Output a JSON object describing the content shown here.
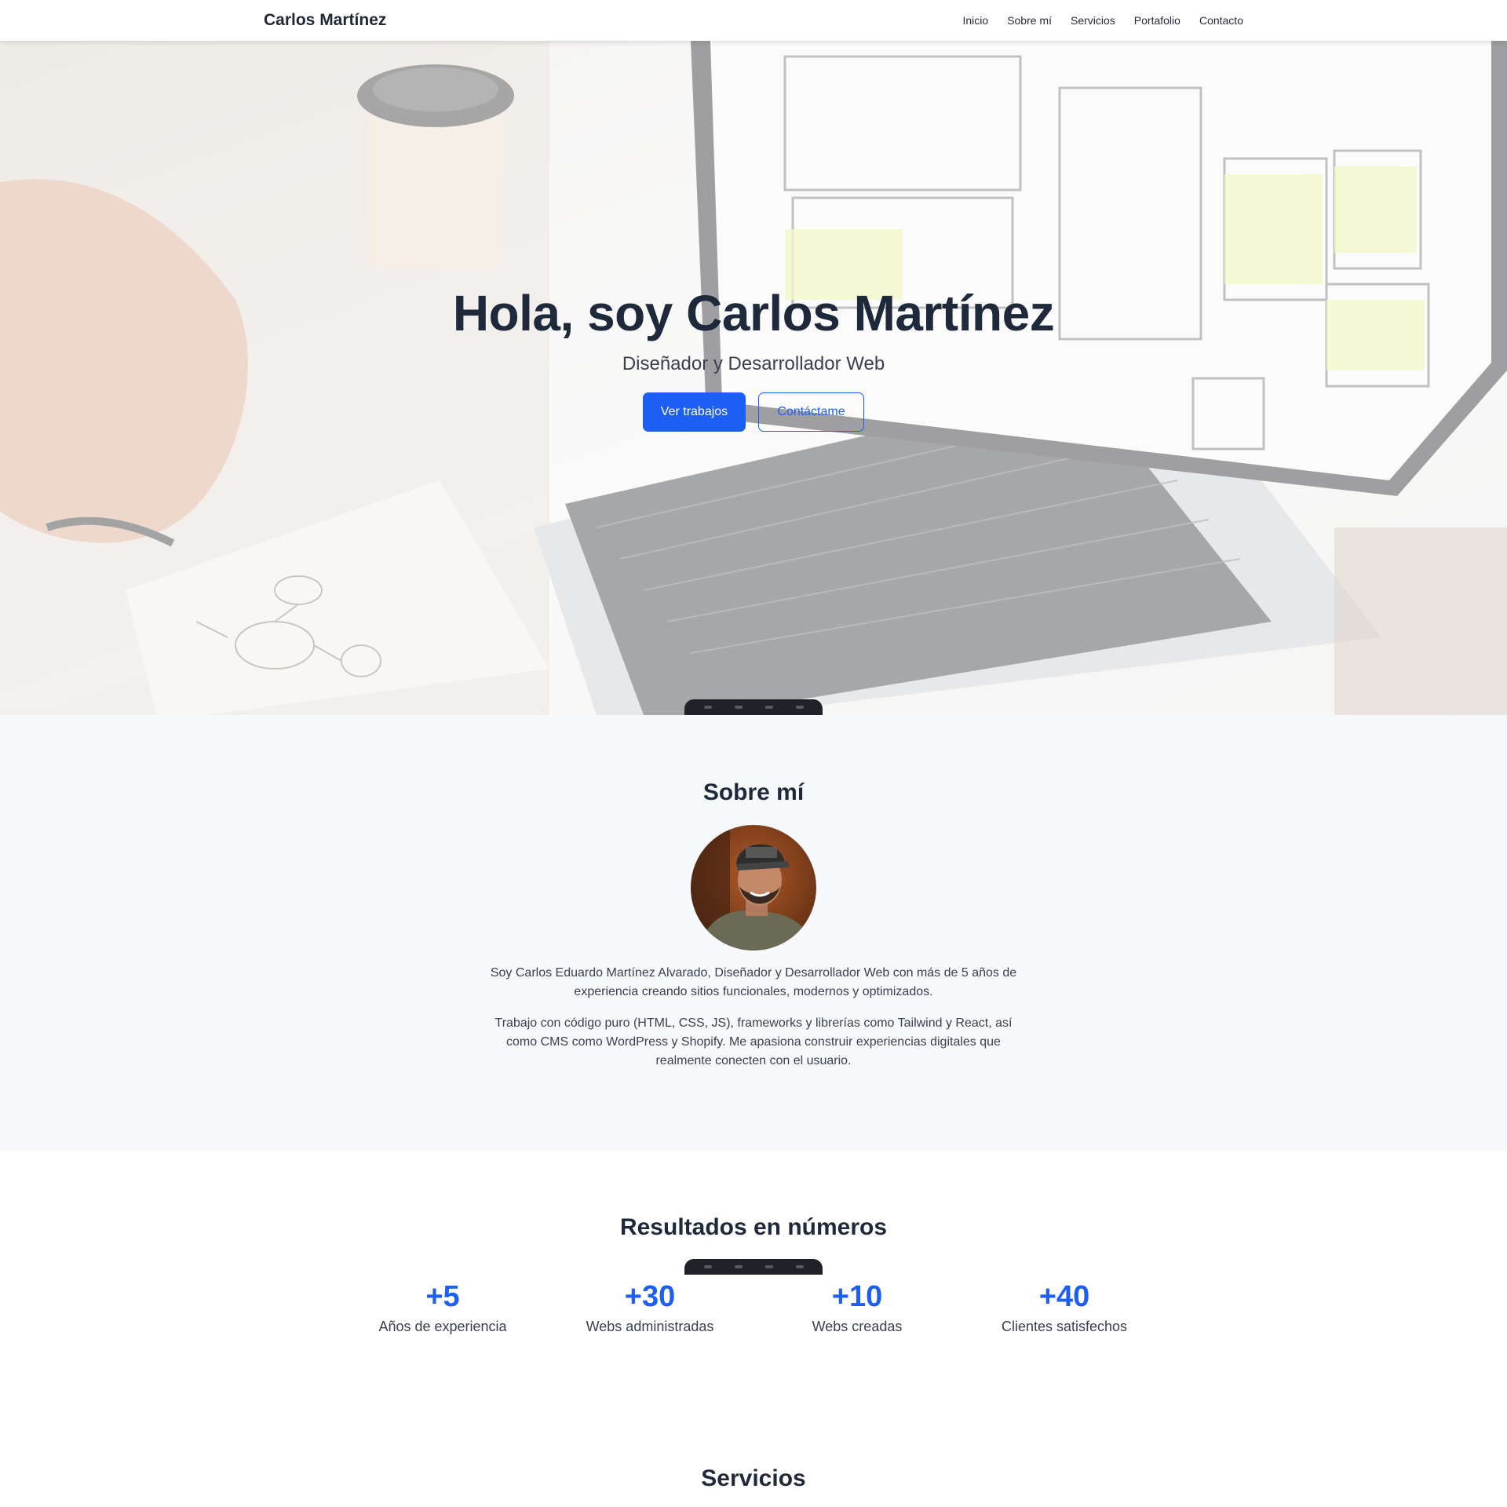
{
  "navbar": {
    "brand": "Carlos Martínez",
    "links": [
      "Inicio",
      "Sobre mí",
      "Servicios",
      "Portafolio",
      "Contacto"
    ]
  },
  "hero": {
    "title": "Hola, soy Carlos Martínez",
    "subtitle": "Diseñador y Desarrollador Web",
    "primary_button": "Ver trabajos",
    "secondary_button": "Contáctame",
    "background_image": "laptop-wireframe-desk-photo"
  },
  "about": {
    "title": "Sobre mí",
    "avatar": "profile-photo",
    "paragraph1": "Soy Carlos Eduardo Martínez Alvarado, Diseñador y Desarrollador Web con más de 5 años de experiencia creando sitios funcionales, modernos y optimizados.",
    "paragraph2": "Trabajo con código puro (HTML, CSS, JS), frameworks y librerías como Tailwind y React, así como CMS como WordPress y Shopify. Me apasiona construir experiencias digitales que realmente conecten con el usuario."
  },
  "stats": {
    "title": "Resultados en números",
    "items": [
      {
        "value": "+5",
        "label": "Años de experiencia"
      },
      {
        "value": "+30",
        "label": "Webs administradas"
      },
      {
        "value": "+10",
        "label": "Webs creadas"
      },
      {
        "value": "+40",
        "label": "Clientes satisfechos"
      }
    ]
  },
  "services": {
    "title": "Servicios"
  },
  "colors": {
    "accent": "#1d5ff5",
    "heading": "#1e293b",
    "section_bg": "#f8f9fb"
  }
}
